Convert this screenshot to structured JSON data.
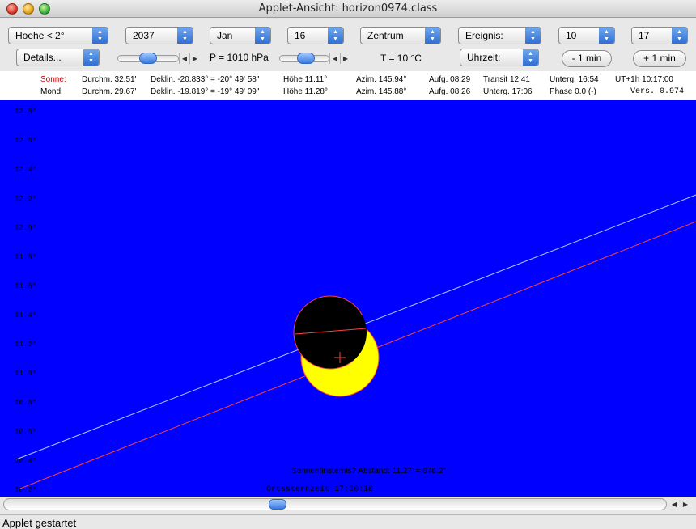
{
  "window": {
    "title": "Applet-Ansicht: horizon0974.class"
  },
  "controls": {
    "altitude_select": "Hoehe < 2°",
    "year_select": "2037",
    "month_select": "Jan",
    "day_select": "16",
    "center_select": "Zentrum",
    "event_select": "Ereignis:",
    "hour_select": "10",
    "minute_select": "17",
    "details_select": "Details...",
    "pressure_label": "P = 1010 hPa",
    "temperature_label": "T = 10 °C",
    "clock_select": "Uhrzeit:",
    "minus_min_button": "- 1 min",
    "plus_min_button": "+ 1 min"
  },
  "info": {
    "sun": {
      "label": "Sonne:",
      "diameter": "Durchm. 32.51'",
      "declination": "Deklin. -20.833° = -20° 49' 58\"",
      "altitude": "Höhe 11.11°",
      "azimuth": "Azim. 145.94°",
      "rise": "Aufg. 08:29",
      "transit": "Transit 12:41",
      "set": "Unterg. 16:54",
      "time": "UT+1h  10:17:00"
    },
    "moon": {
      "label": "Mond:",
      "diameter": "Durchm. 29.67'",
      "declination": "Deklin. -19.819° = -19° 49' 09\"",
      "altitude": "Höhe 11.28°",
      "azimuth": "Azim. 145.88°",
      "rise": "Aufg. 08:26",
      "set": "Unterg. 17:06",
      "phase": "Phase 0.0 (-)",
      "version": "Vers. 0.974"
    }
  },
  "sky": {
    "y_ticks": [
      "12.8°",
      "12.6°",
      "12.4°",
      "12.2°",
      "12.0°",
      "11.8°",
      "11.6°",
      "11.4°",
      "11.2°",
      "11.0°",
      "10.8°",
      "10.6°",
      "10.4°",
      "10.2°"
    ],
    "eclipse_text": "Sonnenfinsternis? Abstand: 11.27' = 678.2\"",
    "sidereal_text": "Ortssternzeit  17:30:18",
    "colors": {
      "sky": "#0000ff",
      "sun": "#ffff00",
      "moon": "#000000",
      "sun_path": "#ff4040",
      "moon_path": "#a8c8ff"
    }
  },
  "status": {
    "text": "Applet gestartet"
  }
}
